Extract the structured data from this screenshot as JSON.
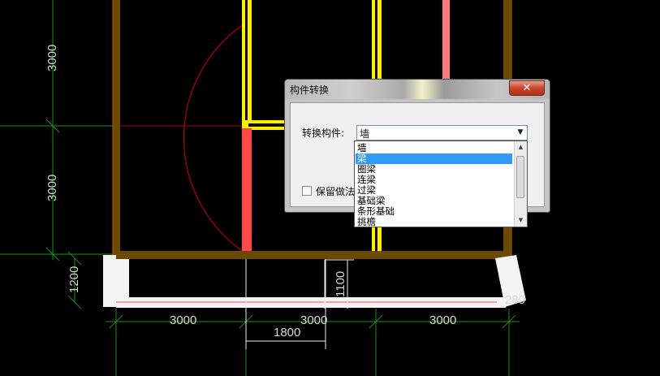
{
  "drawing": {
    "dims": {
      "left_top": "3000",
      "left_mid": "3000",
      "left_low": "1200",
      "bottom_1": "3000",
      "bottom_2": "3000",
      "bottom_3": "3000",
      "window_width": "1800",
      "window_height": "1100",
      "corner": "280"
    },
    "colors": {
      "background": "#000000",
      "wall": "#6b4a00",
      "beam_yellow": "#ffee00",
      "beam_red": "#ff4a4a",
      "beam_pink": "#ff7a7a",
      "axis_green": "#1e8f1e",
      "arc_red": "#b40000"
    }
  },
  "dialog": {
    "title": "构件转换",
    "close_label": "✕",
    "convert_label": "转换构件:",
    "selected_value": "墙",
    "arrow_icon": "dropdown-arrow",
    "keep_label": "保留做法",
    "options": [
      "墙",
      "梁",
      "圈梁",
      "连梁",
      "过梁",
      "基础梁",
      "条形基础",
      "挑檐"
    ],
    "highlighted_index": 1
  }
}
